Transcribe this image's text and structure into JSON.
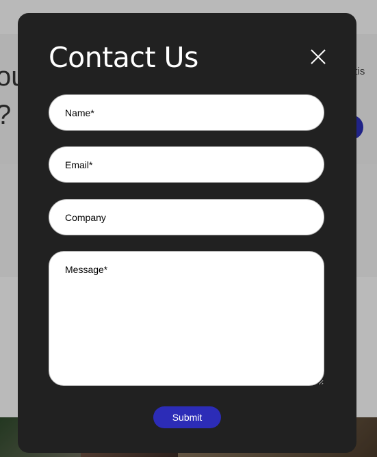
{
  "background": {
    "hero_line_1": "ou",
    "hero_line_2": "?",
    "nav_link": "ertis"
  },
  "modal": {
    "title": "Contact Us",
    "close_icon": "close-icon",
    "fields": {
      "name_placeholder": "Name*",
      "email_placeholder": "Email*",
      "company_placeholder": "Company",
      "message_placeholder": "Message*"
    },
    "submit_label": "Submit"
  },
  "colors": {
    "modal_bg": "#212121",
    "accent": "#2c2cb7",
    "field_bg": "#ffffff",
    "title_text": "#ffffff"
  }
}
